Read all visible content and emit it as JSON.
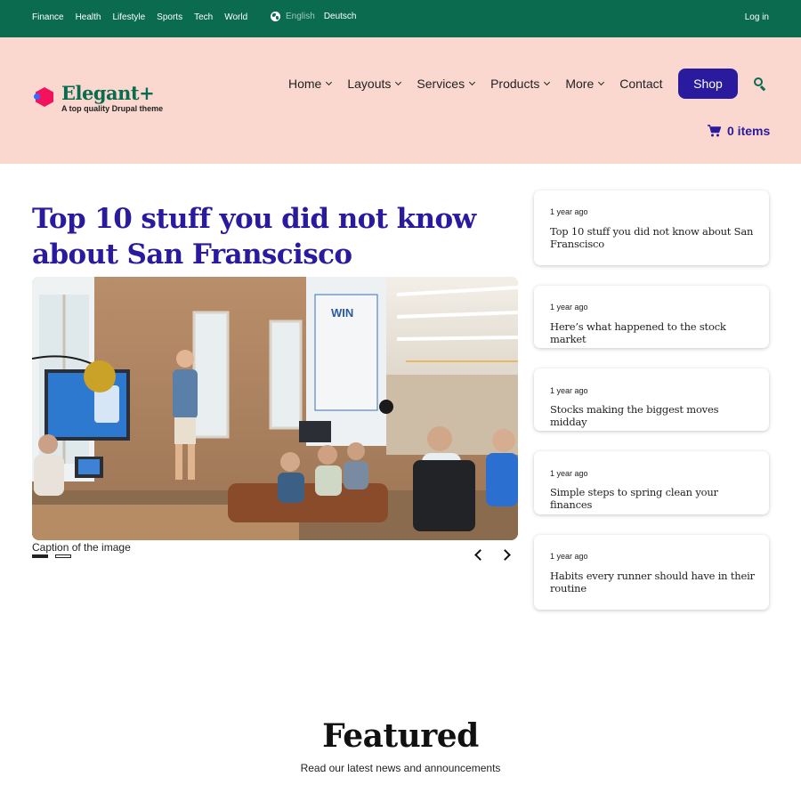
{
  "topbar": {
    "links": [
      "Finance",
      "Health",
      "Lifestyle",
      "Sports",
      "Tech",
      "World"
    ],
    "languages": {
      "current": "English",
      "other": "Deutsch"
    },
    "login": "Log in"
  },
  "brand": {
    "name": "Elegant+",
    "tagline": "A top quality Drupal theme"
  },
  "nav": {
    "items": [
      {
        "label": "Home",
        "has_dropdown": true
      },
      {
        "label": "Layouts",
        "has_dropdown": true
      },
      {
        "label": "Services",
        "has_dropdown": true
      },
      {
        "label": "Products",
        "has_dropdown": true
      },
      {
        "label": "More",
        "has_dropdown": true
      },
      {
        "label": "Contact",
        "has_dropdown": false
      }
    ],
    "shop_label": "Shop",
    "cart_label": "0 items"
  },
  "article": {
    "title": "Top 10 stuff you did not know about San Franscisco",
    "caption": "Caption of the image",
    "slides_total": 2,
    "slide_active": 1
  },
  "sidebar": {
    "cards": [
      {
        "ago": "1 year ago",
        "title": "Top 10 stuff you did not know about San Franscisco"
      },
      {
        "ago": "1 year ago",
        "title": "Here’s what happened to the stock market"
      },
      {
        "ago": "1 year ago",
        "title": "Stocks making the biggest moves midday"
      },
      {
        "ago": "1 year ago",
        "title": "Simple steps to spring clean your finances"
      },
      {
        "ago": "1 year ago",
        "title": "Habits every runner should have in their routine"
      }
    ]
  },
  "featured": {
    "title": "Featured",
    "subtitle": "Read our latest news and announcements"
  },
  "colors": {
    "topbar_bg": "#0b6b4f",
    "header_bg": "#fad8d0",
    "accent": "#2a1a9e",
    "brand_green": "#0b6b4f",
    "logo_pink": "#f3125b"
  }
}
